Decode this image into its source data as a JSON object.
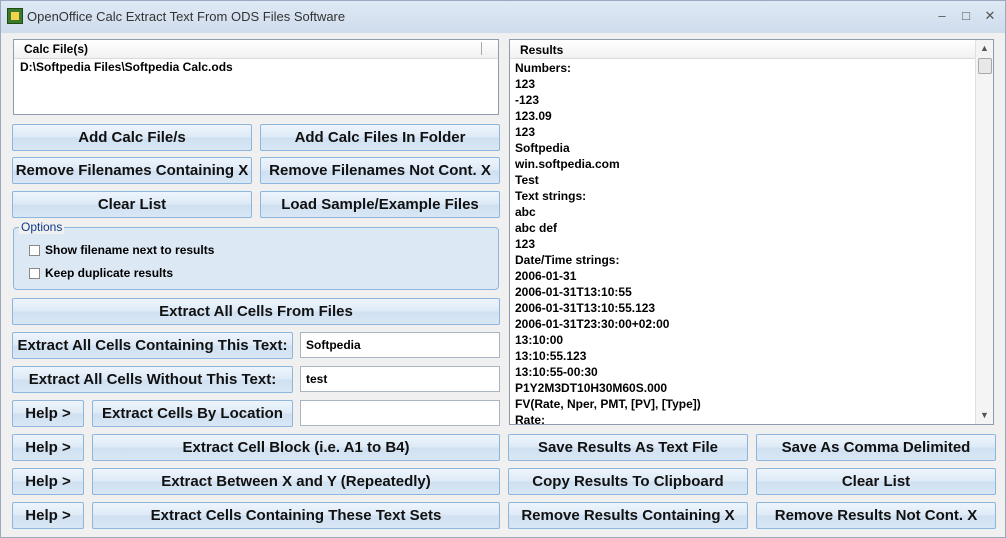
{
  "window": {
    "title": "OpenOffice Calc Extract Text From ODS Files Software"
  },
  "files": {
    "header": "Calc File(s)",
    "items": [
      "D:\\Softpedia Files\\Softpedia Calc.ods"
    ]
  },
  "buttons": {
    "add_files": "Add Calc File/s",
    "add_folder": "Add Calc Files In Folder",
    "remove_containing": "Remove Filenames Containing X",
    "remove_not_containing": "Remove Filenames Not Cont. X",
    "clear_list": "Clear List",
    "load_sample": "Load Sample/Example Files",
    "extract_all": "Extract All Cells From Files",
    "extract_containing": "Extract All Cells Containing This Text:",
    "extract_without": "Extract All Cells Without This Text:",
    "help": "Help >",
    "extract_location": "Extract Cells By Location",
    "extract_block": "Extract Cell Block (i.e. A1 to B4)",
    "extract_between": "Extract Between X and Y (Repeatedly)",
    "extract_sets": "Extract Cells Containing These Text Sets",
    "save_text": "Save Results As Text File",
    "save_comma": "Save As Comma Delimited",
    "copy_clipboard": "Copy Results To Clipboard",
    "clear_results": "Clear List",
    "remove_results_containing": "Remove Results Containing X",
    "remove_results_not": "Remove Results Not Cont. X"
  },
  "options": {
    "legend": "Options",
    "show_filename": "Show filename next to results",
    "keep_duplicates": "Keep duplicate results"
  },
  "inputs": {
    "containing_value": "Softpedia",
    "without_value": "test",
    "location_value": ""
  },
  "results": {
    "header": "Results",
    "lines": [
      "Numbers:",
      "123",
      "-123",
      "123.09",
      "123",
      "Softpedia",
      "win.softpedia.com",
      "Test",
      "Text strings:",
      "abc",
      "abc def",
      "123",
      "Date/Time strings:",
      "2006-01-31",
      "2006-01-31T13:10:55",
      "2006-01-31T13:10:55.123",
      "2006-01-31T23:30:00+02:00",
      "13:10:00",
      "13:10:55.123",
      "13:10:55-00:30",
      "P1Y2M3DT10H30M60S.000",
      "FV(Rate, Nper, PMT, [PV], [Type])",
      "Rate:"
    ]
  }
}
